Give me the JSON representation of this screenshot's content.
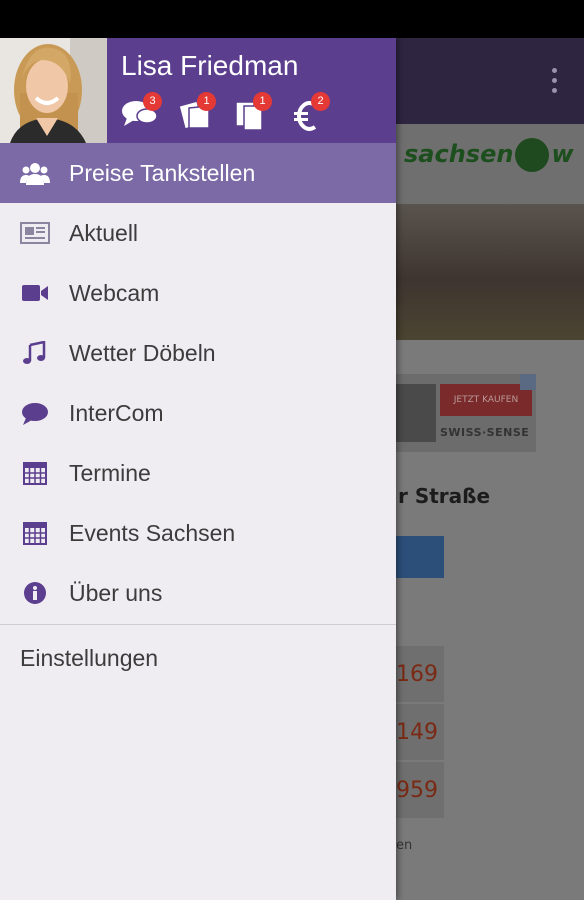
{
  "colors": {
    "header_purple": "#5c3e8e",
    "active_item": "#7b6aa6",
    "icon_purple": "#5c3e8e",
    "badge_red": "#e53935",
    "drawer_bg": "#efedf2"
  },
  "drawer": {
    "user_name": "Lisa Friedman",
    "badges": [
      {
        "icon": "chat-bubbles-icon",
        "count": "3"
      },
      {
        "icon": "tickets-icon",
        "count": "1"
      },
      {
        "icon": "documents-icon",
        "count": "1"
      },
      {
        "icon": "euro-icon",
        "count": "2"
      }
    ],
    "items": [
      {
        "label": "Preise Tankstellen",
        "icon": "group-icon",
        "active": true
      },
      {
        "label": "Aktuell",
        "icon": "newspaper-icon"
      },
      {
        "label": "Webcam",
        "icon": "video-camera-icon"
      },
      {
        "label": "Wetter Döbeln",
        "icon": "music-note-icon"
      },
      {
        "label": "InterCom",
        "icon": "chat-bubble-icon"
      },
      {
        "label": "Termine",
        "icon": "calendar-icon"
      },
      {
        "label": "Events Sachsen",
        "icon": "calendar-icon"
      },
      {
        "label": "Über uns",
        "icon": "info-icon"
      }
    ],
    "settings_label": "Einstellungen"
  },
  "background": {
    "logo_left": "sachsen",
    "logo_right": "w",
    "ad_button": "JETZT KAUFEN",
    "ad_brand": "SWISS·SENSE",
    "heading": "r Straße",
    "prices": [
      "169",
      "149",
      "959"
    ],
    "footer_fragment": "en"
  }
}
